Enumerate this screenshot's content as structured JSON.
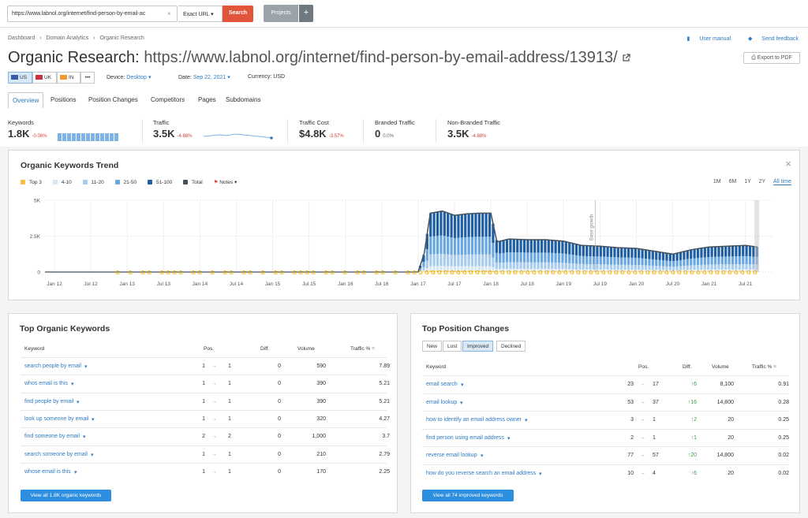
{
  "topbar": {
    "url_value": "https://www.labnol.org/internet/find-person-by-email-ac",
    "match_type": "Exact URL",
    "search_label": "Search",
    "projects_label": "Projects",
    "plus_label": "+"
  },
  "breadcrumb": [
    "Dashboard",
    "›",
    "Domain Analytics",
    "›",
    "Organic Research"
  ],
  "links": {
    "manual": "User manual",
    "feedback": "Send feedback"
  },
  "title": {
    "prefix": "Organic Research:",
    "url": "https://www.labnol.org/internet/find-person-by-email-address/13913/"
  },
  "export_label": "Export to PDF",
  "databases": [
    {
      "code": "US",
      "flag_color": "#3c5aa8",
      "active": true
    },
    {
      "code": "UK",
      "flag_color": "#c8333c",
      "active": false
    },
    {
      "code": "IN",
      "flag_color": "#f39a2c",
      "active": false
    },
    {
      "code": "•••",
      "flag_color": "",
      "active": false
    }
  ],
  "meta": {
    "device_label": "Device:",
    "device_value": "Desktop",
    "date_label": "Date:",
    "date_value": "Sep 22, 2021",
    "currency": "Currency: USD"
  },
  "tabs": [
    "Overview",
    "Positions",
    "Position Changes",
    "Competitors",
    "Pages",
    "Subdomains"
  ],
  "metrics": [
    {
      "label": "Keywords",
      "value": "1.8K",
      "change": "-0.06%",
      "change_type": "neg"
    },
    {
      "label": "Traffic",
      "value": "3.5K",
      "change": "-4.88%",
      "change_type": "neg"
    },
    {
      "label": "Traffic Cost",
      "value": "$4.8K",
      "change": "-3.57%",
      "change_type": "neg"
    },
    {
      "label": "Branded Traffic",
      "value": "0",
      "change": "0.0%",
      "change_type": "neu"
    },
    {
      "label": "Non-Branded Traffic",
      "value": "3.5K",
      "change": "-4.88%",
      "change_type": "neg"
    }
  ],
  "trend": {
    "title": "Organic Keywords Trend",
    "close": "×",
    "legend": [
      {
        "label": "Top 3",
        "color": "#f5c146"
      },
      {
        "label": "4-10",
        "color": "#d6e7f7"
      },
      {
        "label": "11-20",
        "color": "#a8ccee"
      },
      {
        "label": "21-50",
        "color": "#6aa7e0"
      },
      {
        "label": "51-100",
        "color": "#1e5fa3"
      },
      {
        "label": "Total",
        "color": "#44525e"
      }
    ],
    "notes_label": "Notes",
    "periods": [
      "1M",
      "6M",
      "1Y",
      "2Y",
      "All time"
    ],
    "annotation": "Base growth"
  },
  "chart_data": {
    "type": "area",
    "title": "Organic Keywords Trend",
    "y_ticks": [
      "5K",
      "2.5K",
      "0"
    ],
    "ylim": [
      0,
      5000
    ],
    "x_ticks": [
      "Jan 12",
      "Jul 12",
      "Jan 13",
      "Jul 13",
      "Jan 14",
      "Jul 14",
      "Jan 15",
      "Jul 15",
      "Jan 16",
      "Jul 16",
      "Jan 17",
      "Jul 17",
      "Jan 18",
      "Jul 18",
      "Jan 19",
      "Jul 19",
      "Jan 20",
      "Jul 20",
      "Jan 21",
      "Jul 21"
    ],
    "x": [
      "Jan 17",
      "Feb 17",
      "Mar 17",
      "May 17",
      "Jul 17",
      "Sep 17",
      "Nov 17",
      "Jan 18",
      "Feb 18",
      "Apr 18",
      "Jul 18",
      "Oct 18",
      "Jan 19",
      "Apr 19",
      "Jul 19",
      "Oct 19",
      "Jan 20",
      "Apr 20",
      "Jul 20",
      "Oct 20",
      "Jan 21",
      "Apr 21",
      "Jul 21",
      "Sep 21"
    ],
    "series": [
      {
        "name": "Total",
        "values": [
          0,
          1300,
          4100,
          4250,
          3950,
          4050,
          4100,
          4100,
          2100,
          2300,
          2250,
          2250,
          2150,
          1850,
          1800,
          1700,
          1650,
          1450,
          1250,
          1550,
          1750,
          1800,
          1850,
          1750
        ]
      }
    ],
    "grid": true,
    "legend_position": "top-left"
  },
  "top_keywords": {
    "title": "Top Organic Keywords",
    "headers": {
      "keyword": "Keyword",
      "pos": "Pos.",
      "diff": "Diff.",
      "volume": "Volume",
      "traffic": "Traffic %"
    },
    "rows": [
      {
        "kw": "search people by email",
        "from": "1",
        "to": "1",
        "diff": "0",
        "volume": "590",
        "traffic": "7.89"
      },
      {
        "kw": "whos email is this",
        "from": "1",
        "to": "1",
        "diff": "0",
        "volume": "390",
        "traffic": "5.21"
      },
      {
        "kw": "find people by email",
        "from": "1",
        "to": "1",
        "diff": "0",
        "volume": "390",
        "traffic": "5.21"
      },
      {
        "kw": "look up someone by email",
        "from": "1",
        "to": "1",
        "diff": "0",
        "volume": "320",
        "traffic": "4.27"
      },
      {
        "kw": "find someone by email",
        "from": "2",
        "to": "2",
        "diff": "0",
        "volume": "1,000",
        "traffic": "3.7"
      },
      {
        "kw": "search someone by email",
        "from": "1",
        "to": "1",
        "diff": "0",
        "volume": "210",
        "traffic": "2.79"
      },
      {
        "kw": "whose email is this",
        "from": "1",
        "to": "1",
        "diff": "0",
        "volume": "170",
        "traffic": "2.25"
      }
    ],
    "button": "View all 1.8K organic keywords"
  },
  "position_changes": {
    "title": "Top Position Changes",
    "filters": [
      "New",
      "Lost",
      "Improved",
      "Declined"
    ],
    "active_filter": "Improved",
    "headers": {
      "keyword": "Keyword",
      "pos": "Pos.",
      "diff": "Diff.",
      "volume": "Volume",
      "traffic": "Traffic %"
    },
    "rows": [
      {
        "kw": "email search",
        "from": "23",
        "to": "17",
        "diff": "6",
        "volume": "8,100",
        "traffic": "0.91"
      },
      {
        "kw": "email lookup",
        "from": "53",
        "to": "37",
        "diff": "16",
        "volume": "14,800",
        "traffic": "0.28"
      },
      {
        "kw": "how to identify an email address owner",
        "from": "3",
        "to": "1",
        "diff": "2",
        "volume": "20",
        "traffic": "0.25"
      },
      {
        "kw": "find person using email address",
        "from": "2",
        "to": "1",
        "diff": "1",
        "volume": "20",
        "traffic": "0.25"
      },
      {
        "kw": "reverse email lookup",
        "from": "77",
        "to": "57",
        "diff": "20",
        "volume": "14,800",
        "traffic": "0.02"
      },
      {
        "kw": "how do you reverse search an email address",
        "from": "10",
        "to": "4",
        "diff": "6",
        "volume": "20",
        "traffic": "0.02"
      }
    ],
    "button": "View all 74 improved keywords"
  }
}
